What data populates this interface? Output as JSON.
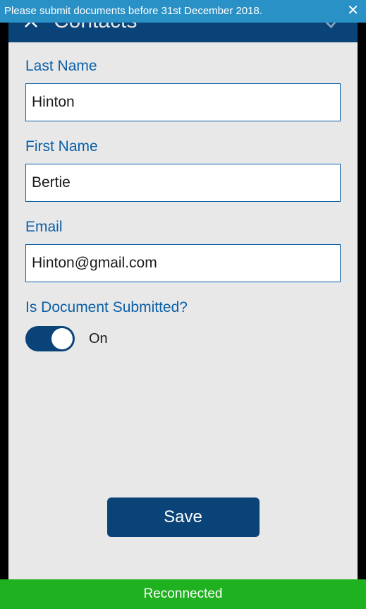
{
  "banner": {
    "text": "Please submit documents before 31st December 2018.",
    "close_icon": "✕"
  },
  "header": {
    "title": "Contacts"
  },
  "form": {
    "last_name": {
      "label": "Last Name",
      "value": "Hinton"
    },
    "first_name": {
      "label": "First Name",
      "value": "Bertie"
    },
    "email": {
      "label": "Email",
      "value": "Hinton@gmail.com"
    },
    "doc_submitted": {
      "label": "Is Document Submitted?",
      "state": "On",
      "value": true
    }
  },
  "buttons": {
    "save": "Save"
  },
  "footer": {
    "status": "Reconnected"
  }
}
